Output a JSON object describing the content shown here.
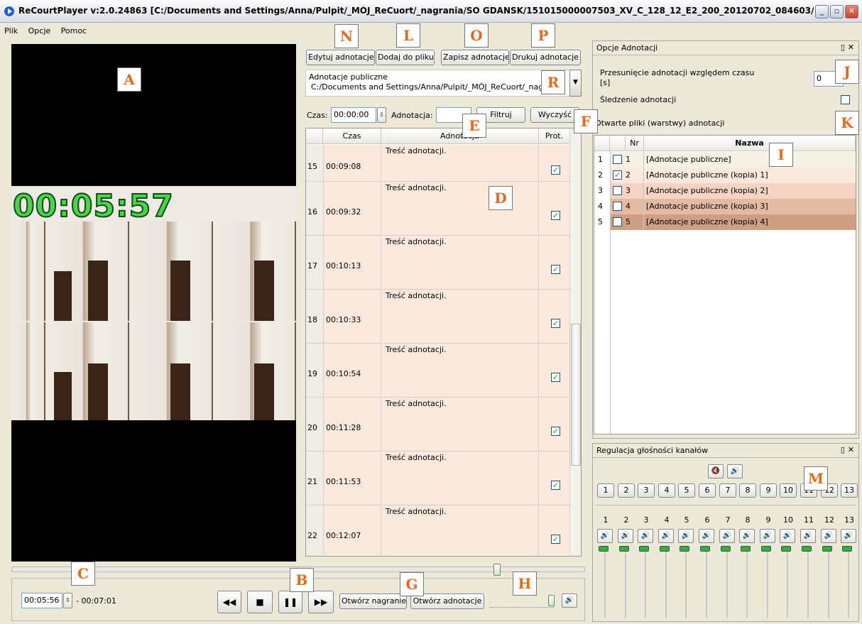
{
  "window": {
    "title": "ReCourtPlayer v:2.0.24863 [C:/Documents and Settings/Anna/Pulpit/_MÓJ_ReCuort/_nagrania/SO GDANSK/151015000007503_XV_C_128_12_E2_200_20120702_084603/15101500000..."
  },
  "menu": [
    "Plik",
    "Opcje",
    "Pomoc"
  ],
  "video": {
    "timestamp": "00:05:57"
  },
  "toolbar": {
    "edit": "Edytuj adnotacje",
    "add": "Dodaj do pliku",
    "save": "Zapisz adnotacje",
    "print": "Drukuj adnotacje"
  },
  "source": {
    "title": "Adnotacje publiczne",
    "path": "C:/Documents and Settings/Anna/Pulpit/_MÓJ_ReCuort/_nag...s"
  },
  "filter": {
    "time_label": "Czas:",
    "time_value": "00:00:00",
    "annotation_label": "Adnotacja:",
    "annotation_value": "",
    "filter_button": "Filtruj",
    "clear_button": "Wyczyść"
  },
  "annotations": {
    "columns": [
      "",
      "Czas",
      "Adnotacja",
      "Prot."
    ],
    "rows": [
      {
        "nr": "15",
        "time": "00:09:08",
        "text": "Treść adnotacji.",
        "prot": true
      },
      {
        "nr": "16",
        "time": "00:09:32",
        "text": "Treść adnotacji.",
        "prot": true
      },
      {
        "nr": "17",
        "time": "00:10:13",
        "text": "Treść adnotacji.",
        "prot": true
      },
      {
        "nr": "18",
        "time": "00:10:33",
        "text": "Treść adnotacji.",
        "prot": true
      },
      {
        "nr": "19",
        "time": "00:10:54",
        "text": "Treść adnotacji.",
        "prot": true
      },
      {
        "nr": "20",
        "time": "00:11:28",
        "text": "Treść adnotacji.",
        "prot": true
      },
      {
        "nr": "21",
        "time": "00:11:53",
        "text": "Treść adnotacji.",
        "prot": true
      },
      {
        "nr": "22",
        "time": "00:12:07",
        "text": "Treść adnotacji.",
        "prot": true
      }
    ]
  },
  "playback": {
    "current_time": "00:05:56",
    "total_time": "- 00:07:01",
    "open_recording": "Otwórz nagranie",
    "open_annotation": "Otwórz adnotacje"
  },
  "options_panel": {
    "title": "Opcje Adnotacji",
    "offset_label_1": "Przesunięcie adnotacji względem czasu",
    "offset_label_2": "[s]",
    "offset_value": "0",
    "tracking_label": "Śledzenie adnotacji",
    "layers_title": "Otwarte pliki (warstwy) adnotacji",
    "layers_columns": [
      "Nr",
      "Nazwa"
    ],
    "layers": [
      {
        "idx": "1",
        "nr": "1",
        "name": "[Adnotacje publiczne]",
        "checked": false,
        "color": "#f5f1e4"
      },
      {
        "idx": "2",
        "nr": "2",
        "name": "[Adnotacje publiczne (kopia) 1]",
        "checked": true,
        "color": "#fbe9dd"
      },
      {
        "idx": "3",
        "nr": "3",
        "name": "[Adnotacje publiczne (kopia) 2]",
        "checked": false,
        "color": "#f6d4c3"
      },
      {
        "idx": "4",
        "nr": "4",
        "name": "[Adnotacje publiczne (kopia) 3]",
        "checked": false,
        "color": "#e3bba3"
      },
      {
        "idx": "5",
        "nr": "5",
        "name": "[Adnotacje publiczne (kopia) 4]",
        "checked": false,
        "color": "#cf9f83"
      }
    ]
  },
  "volume_panel": {
    "title": "Regulacja głośności kanałów",
    "channels": [
      "1",
      "2",
      "3",
      "4",
      "5",
      "6",
      "7",
      "8",
      "9",
      "10",
      "11",
      "12",
      "13"
    ]
  },
  "markers": [
    "A",
    "B",
    "C",
    "D",
    "E",
    "F",
    "G",
    "H",
    "I",
    "J",
    "K",
    "L",
    "M",
    "N",
    "O",
    "P",
    "R"
  ]
}
